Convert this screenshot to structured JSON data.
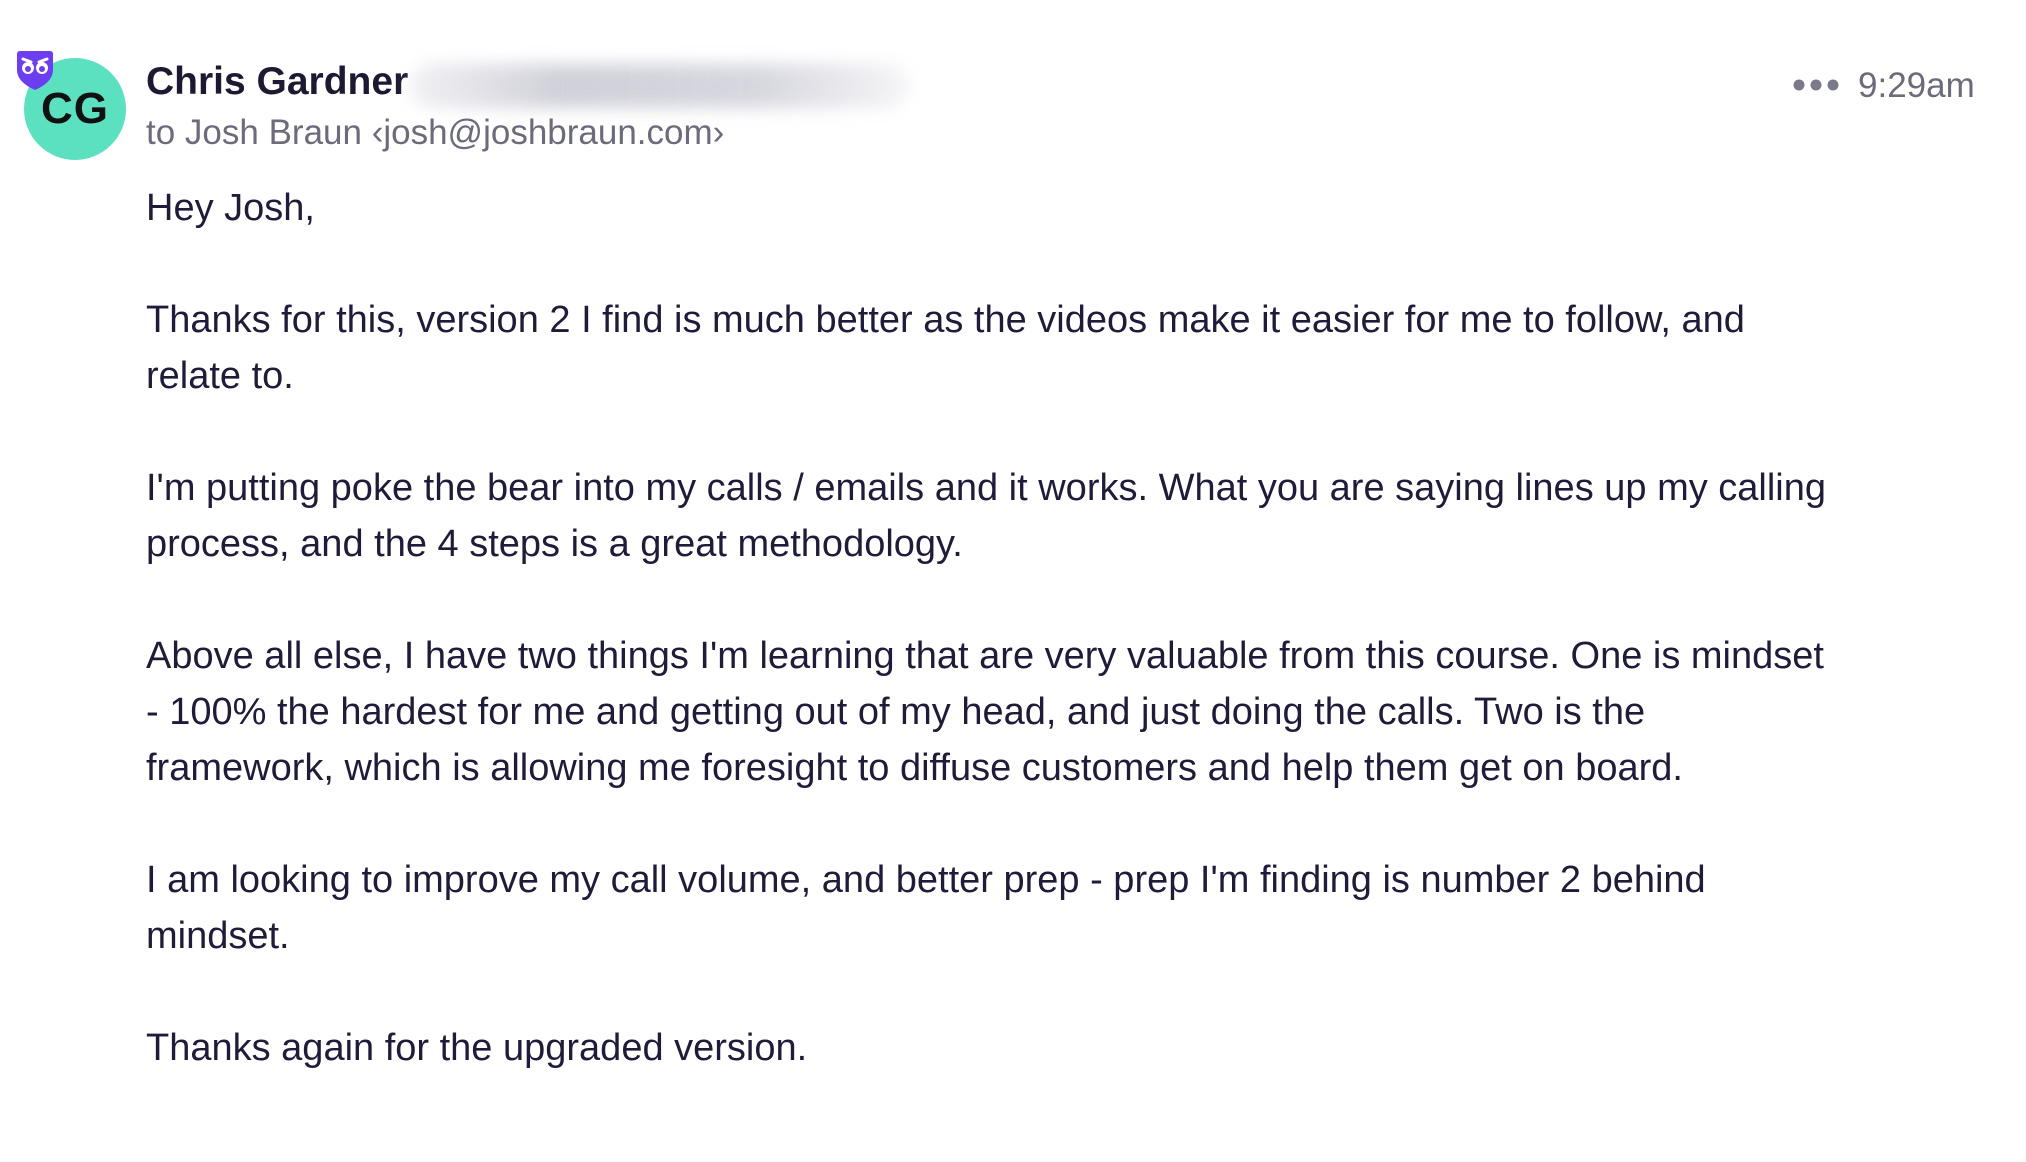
{
  "sender": {
    "initials": "CG",
    "name": "Chris Gardner",
    "avatar_color": "#5ce1c0"
  },
  "recipient_line": "to Josh Braun ‹josh@joshbraun.com›",
  "time": "9:29am",
  "icons": {
    "shield": "superhuman-shield-icon",
    "more": "more-horizontal-icon"
  },
  "body": {
    "paragraphs": [
      "Hey Josh,",
      "Thanks for this, version 2 I find is much better as the videos make it easier for me to follow, and relate to.",
      "I'm putting poke the bear into my calls / emails and it works. What you are saying lines up my calling process, and the 4 steps is a great methodology.",
      "Above all else, I have two things I'm learning that are very valuable from this course. One is mindset - 100% the hardest for me and getting out of my head, and just doing the calls. Two is the framework, which is allowing me foresight to diffuse customers and help them get on board.",
      "I am looking to improve my call volume, and better prep - prep I'm finding is number 2 behind mindset.",
      "Thanks again for the upgraded version."
    ]
  }
}
